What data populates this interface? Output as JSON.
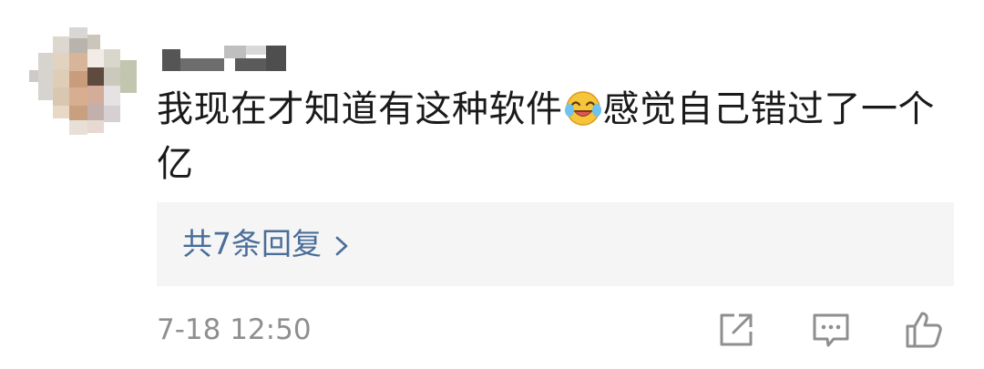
{
  "comment": {
    "text_before_emoji": "我现在才知道有这种软件",
    "emoji_icon": "laughing-crying-emoji",
    "text_after_emoji": "感觉自己错过了一个亿",
    "reply_link_label": "共7条回复",
    "timestamp": "7-18 12:50"
  },
  "icons": {
    "share": "share-icon",
    "comment": "comment-icon",
    "like": "thumbs-up-icon",
    "chevron": "chevron-right-icon"
  },
  "colors": {
    "text": "#1a1a1a",
    "link": "#4a6d99",
    "muted": "#8f8f8f",
    "reply_bg": "#f5f5f5"
  }
}
